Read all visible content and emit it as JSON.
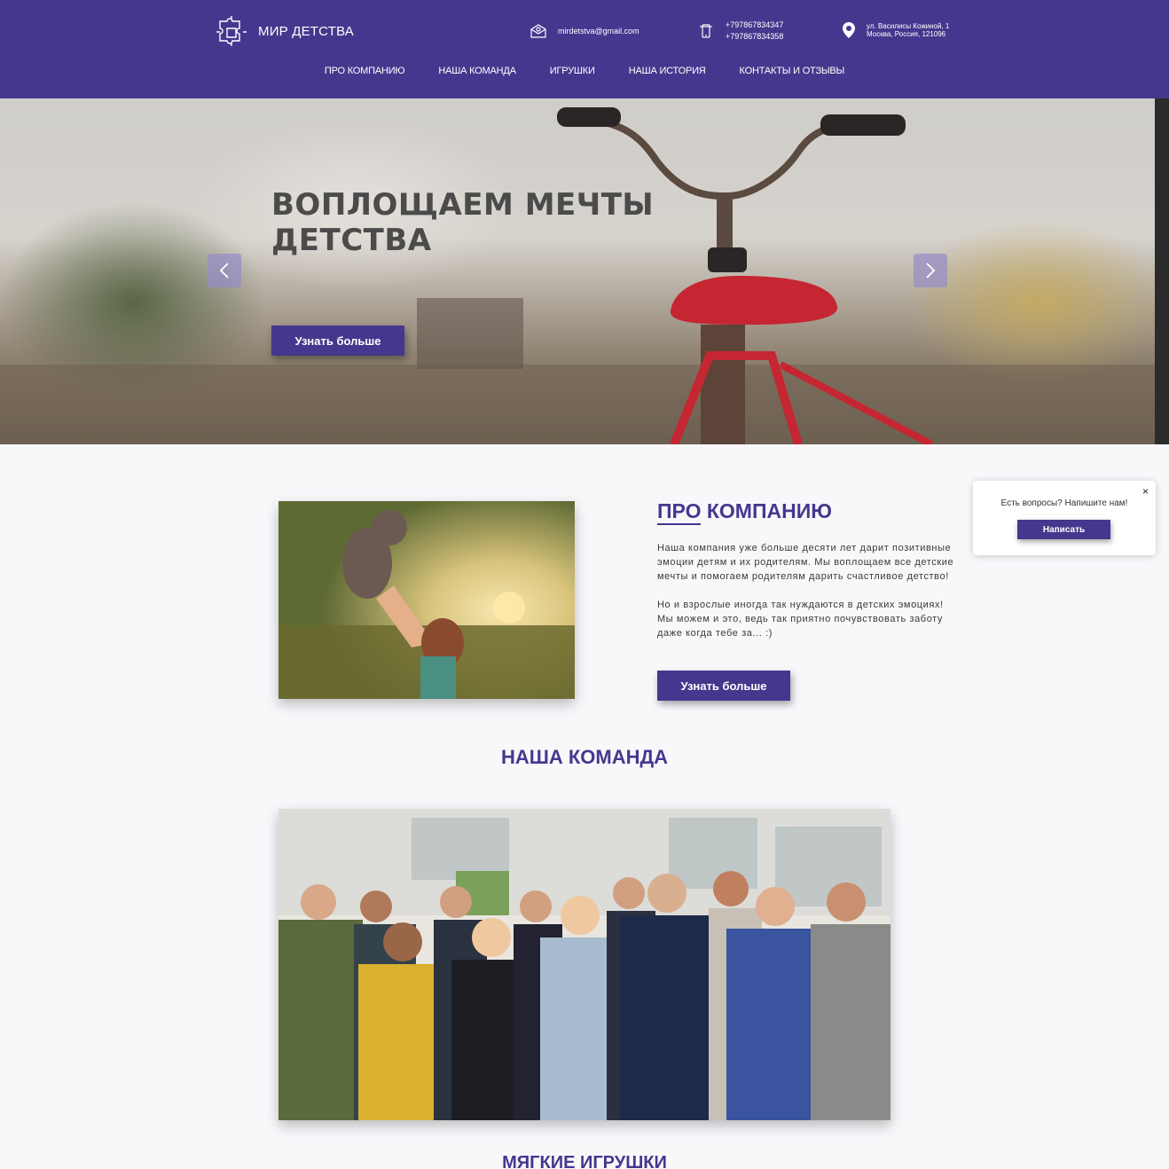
{
  "brand": {
    "name": "МИР ДЕТСТВА"
  },
  "contacts": {
    "email": "mirdetstva@gmail.com",
    "phone1": "+797867834347",
    "phone2": "+797867834358",
    "address_line1": "ул. Василисы Кожиной, 1",
    "address_line2": "Москва, Россия, 121096"
  },
  "nav": {
    "items": [
      "ПРО КОМПАНИЮ",
      "НАША КОМАНДА",
      "ИГРУШКИ",
      "НАША ИСТОРИЯ",
      "КОНТАКТЫ И ОТЗЫВЫ"
    ]
  },
  "hero": {
    "title_line1": "ВОПЛОЩАЕМ МЕЧТЫ",
    "title_line2": "ДЕТСТВА",
    "button_label": "Узнать больше"
  },
  "about": {
    "title_underlined": "ПРО",
    "title_rest": " КОМПАНИЮ",
    "paragraph1": "Наша компания уже больше десяти лет дарит позитивные эмоции детям и их родителям. Мы воплощаем все детские мечты и помогаем родителям дарить счастливое детство!",
    "paragraph2": "Но и взрослые иногда так нуждаются в детских эмоциях! Мы можем и это, ведь так приятно почувствовать заботу даже когда тебе за... :)",
    "button_label": "Узнать больше"
  },
  "chat_widget": {
    "question": "Есть вопросы? Напишите нам!",
    "button_label": "Написать",
    "close_glyph": "×"
  },
  "team": {
    "title": "НАША КОМАНДА"
  },
  "toys": {
    "title": "МЯГКИЕ ИГРУШКИ"
  },
  "colors": {
    "accent": "#44388e",
    "background": "#f8f8fb"
  }
}
